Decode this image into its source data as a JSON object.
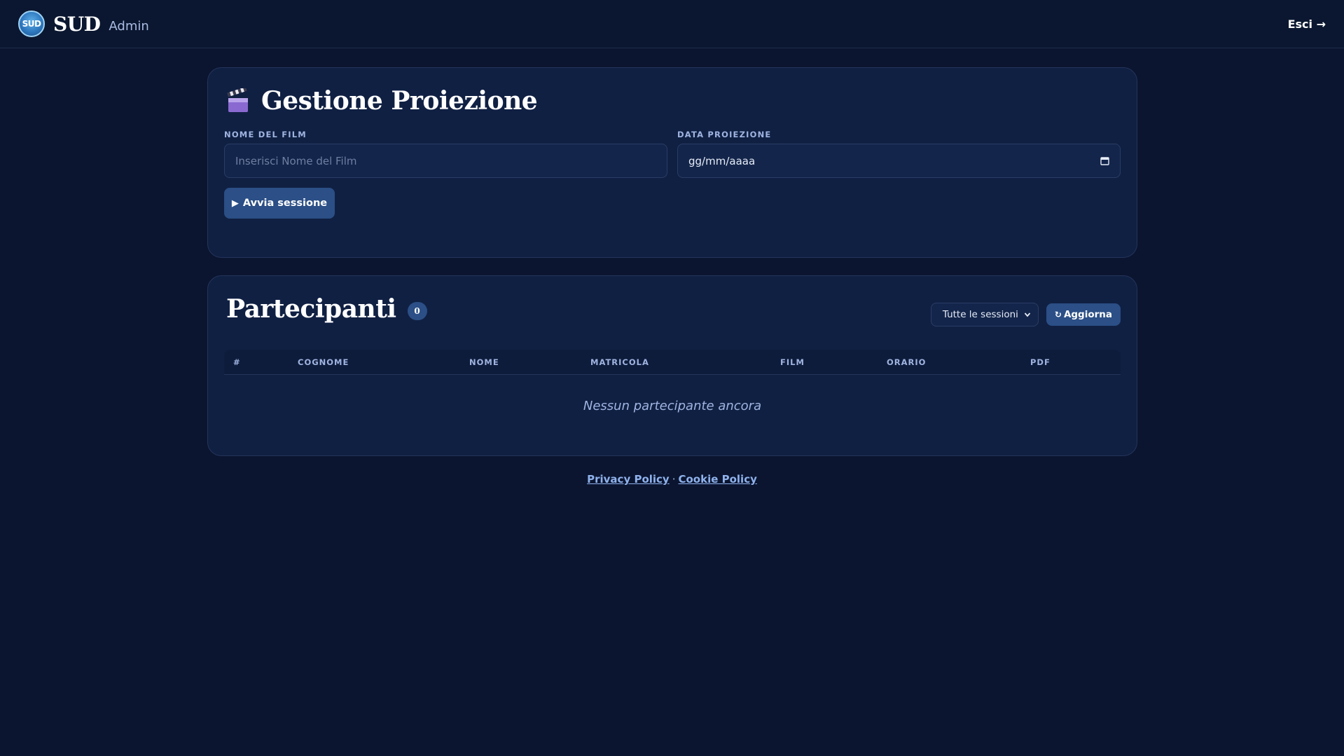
{
  "header": {
    "logo_text": "SUD",
    "brand": "SUD",
    "role": "Admin",
    "logout": "Esci →"
  },
  "screening": {
    "title": "Gestione Proiezione",
    "film_label": "NOME DEL FILM",
    "film_placeholder": "Inserisci Nome del Film",
    "date_label": "DATA PROIEZIONE",
    "date_value": "gg/mm/aaaa",
    "start_button": "Avvia sessione",
    "start_icon": "▶"
  },
  "participants": {
    "title": "Partecipanti",
    "count": "0",
    "session_filter": "Tutte le sessioni",
    "refresh_icon": "↻",
    "refresh_button": "Aggiorna",
    "columns": [
      "#",
      "COGNOME",
      "NOME",
      "MATRICOLA",
      "FILM",
      "ORARIO",
      "PDF"
    ],
    "empty_message": "Nessun partecipante ancora"
  },
  "footer": {
    "privacy": "Privacy Policy",
    "separator": "·",
    "cookie": "Cookie Policy"
  },
  "colors": {
    "background": "#0b1530",
    "card": "#102043",
    "accent": "#2b4f86",
    "muted": "#9fb4e0"
  }
}
